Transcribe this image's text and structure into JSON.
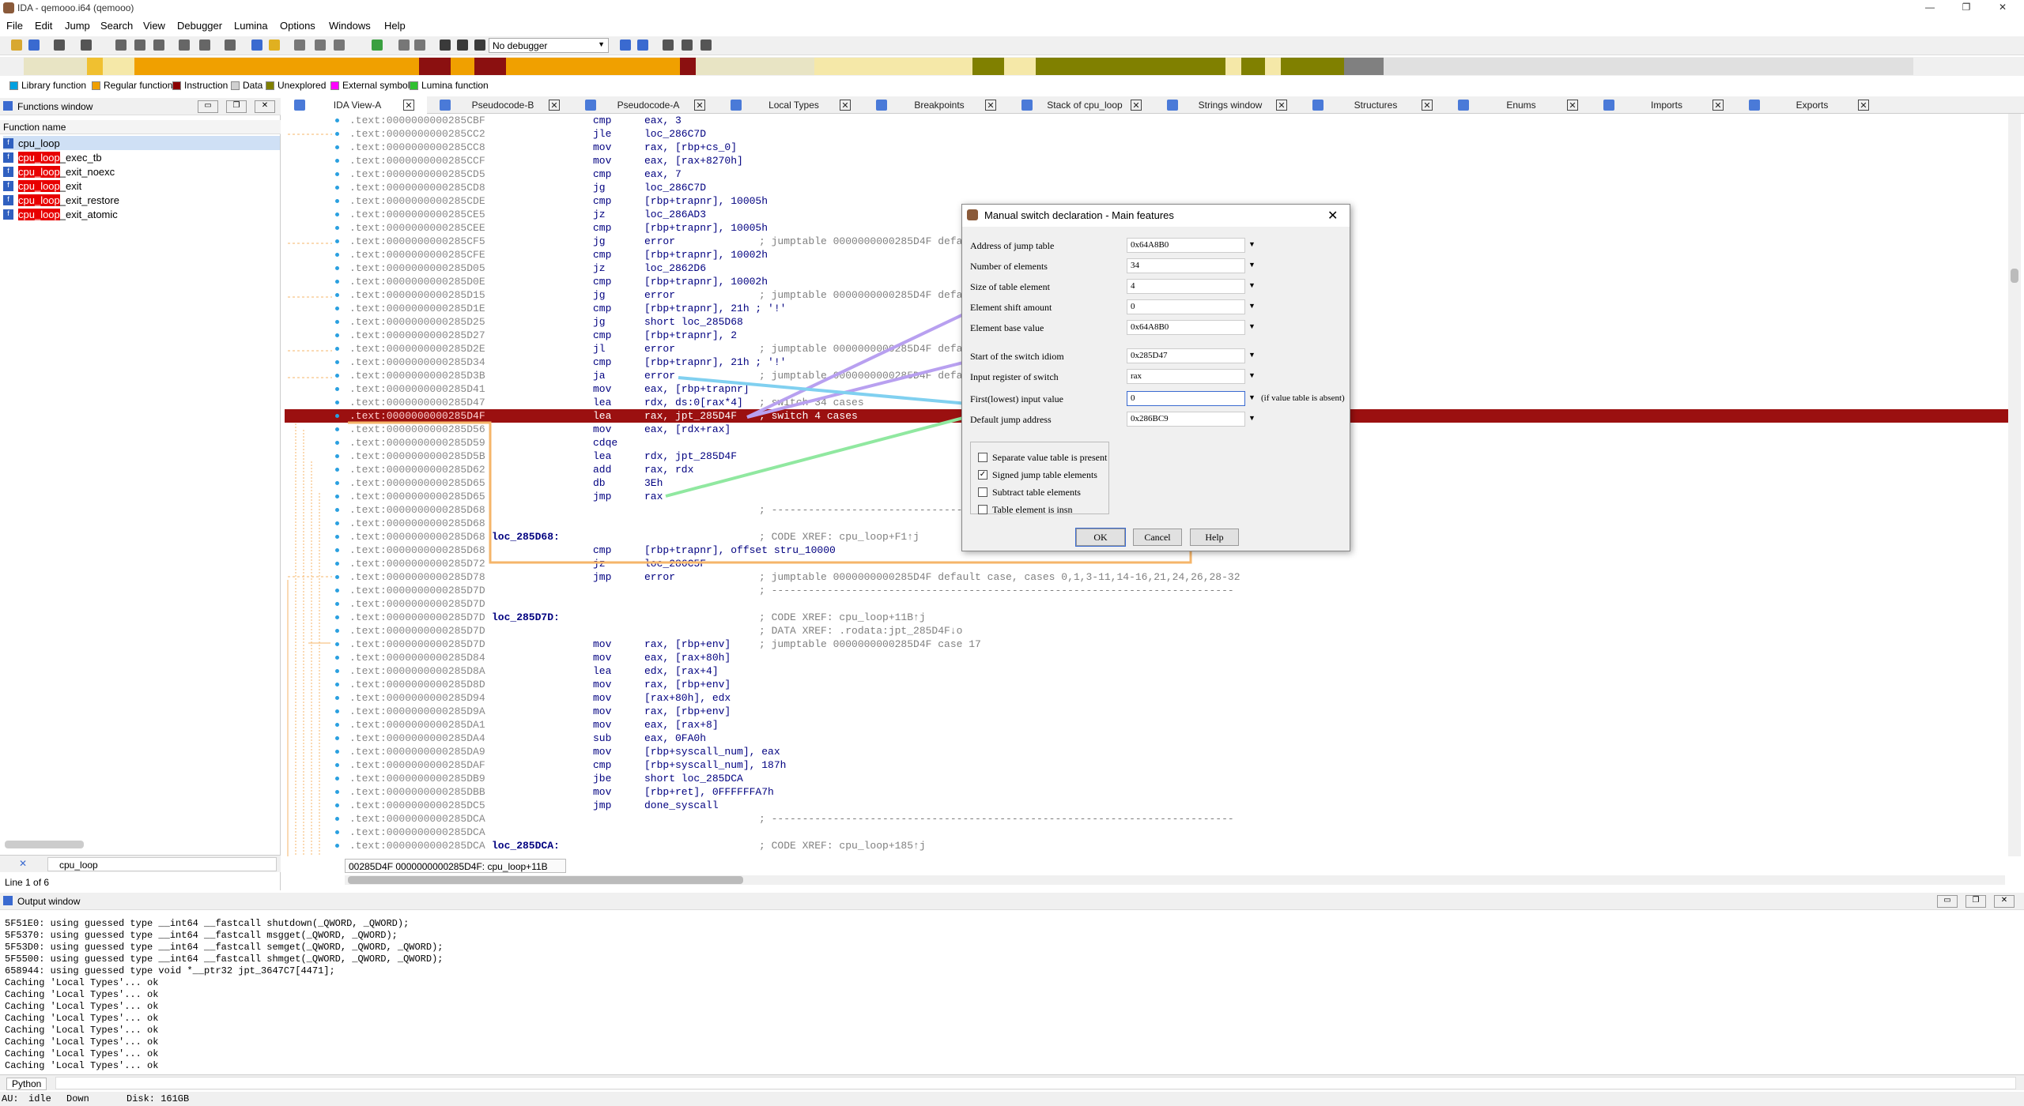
{
  "window": {
    "title": "IDA - qemooo.i64 (qemooo)"
  },
  "menu": [
    "File",
    "Edit",
    "Jump",
    "Search",
    "View",
    "Debugger",
    "Lumina",
    "Options",
    "Windows",
    "Help"
  ],
  "toolbar": {
    "debugger": "No debugger"
  },
  "legend": [
    {
      "label": "Library function",
      "color": "#00a0e0"
    },
    {
      "label": "Regular function",
      "color": "#f0a000"
    },
    {
      "label": "Instruction",
      "color": "#8b0000"
    },
    {
      "label": "Data",
      "color": "#d0d0d0"
    },
    {
      "label": "Unexplored",
      "color": "#808000"
    },
    {
      "label": "External symbol",
      "color": "#ff00ff"
    },
    {
      "label": "Lumina function",
      "color": "#30c030"
    }
  ],
  "functions": {
    "title": "Functions window",
    "column": "Function name",
    "items": [
      {
        "hl": "",
        "rest": "cpu_loop"
      },
      {
        "hl": "cpu_loop",
        "rest": "_exec_tb"
      },
      {
        "hl": "cpu_loop",
        "rest": "_exit_noexc"
      },
      {
        "hl": "cpu_loop",
        "rest": "_exit"
      },
      {
        "hl": "cpu_loop",
        "rest": "_exit_restore"
      },
      {
        "hl": "cpu_loop",
        "rest": "_exit_atomic"
      }
    ],
    "filter": "cpu_loop",
    "line_info": "Line 1 of 6"
  },
  "tabs": [
    "IDA View-A",
    "Pseudocode-B",
    "Pseudocode-A",
    "Local Types",
    "Breakpoints",
    "Stack of cpu_loop",
    "Strings window",
    "Structures",
    "Enums",
    "Imports",
    "Exports"
  ],
  "code": [
    {
      "a": ".text:0000000000285CBF",
      "m": "cmp",
      "o": "eax, 3"
    },
    {
      "a": ".text:0000000000285CC2",
      "m": "jle",
      "o": "loc_286C7D"
    },
    {
      "a": ".text:0000000000285CC8",
      "m": "mov",
      "o": "rax, [rbp+cs_0]"
    },
    {
      "a": ".text:0000000000285CCF",
      "m": "mov",
      "o": "eax, [rax+8270h]"
    },
    {
      "a": ".text:0000000000285CD5",
      "m": "cmp",
      "o": "eax, 7"
    },
    {
      "a": ".text:0000000000285CD8",
      "m": "jg",
      "o": "loc_286C7D"
    },
    {
      "a": ".text:0000000000285CDE",
      "m": "cmp",
      "o": "[rbp+trapnr], 10005h"
    },
    {
      "a": ".text:0000000000285CE5",
      "m": "jz",
      "o": "loc_286AD3"
    },
    {
      "a": ".text:0000000000285CEE",
      "m": "cmp",
      "o": "[rbp+trapnr], 10005h"
    },
    {
      "a": ".text:0000000000285CF5",
      "m": "jg",
      "o": "error",
      "c": "; jumptable 0000000000285D4F defau"
    },
    {
      "a": ".text:0000000000285CFE",
      "m": "cmp",
      "o": "[rbp+trapnr], 10002h"
    },
    {
      "a": ".text:0000000000285D05",
      "m": "jz",
      "o": "loc_2862D6"
    },
    {
      "a": ".text:0000000000285D0E",
      "m": "cmp",
      "o": "[rbp+trapnr], 10002h"
    },
    {
      "a": ".text:0000000000285D15",
      "m": "jg",
      "o": "error",
      "c": "; jumptable 0000000000285D4F defau"
    },
    {
      "a": ".text:0000000000285D1E",
      "m": "cmp",
      "o": "[rbp+trapnr], 21h ; '!'"
    },
    {
      "a": ".text:0000000000285D25",
      "m": "jg",
      "o": "short loc_285D68"
    },
    {
      "a": ".text:0000000000285D27",
      "m": "cmp",
      "o": "[rbp+trapnr], 2"
    },
    {
      "a": ".text:0000000000285D2E",
      "m": "jl",
      "o": "error",
      "c": "; jumptable 0000000000285D4F defau"
    },
    {
      "a": ".text:0000000000285D34",
      "m": "cmp",
      "o": "[rbp+trapnr], 21h ; '!'"
    },
    {
      "a": ".text:0000000000285D3B",
      "m": "ja",
      "o": "error",
      "c": "; jumptable 0000000000285D4F defau"
    },
    {
      "a": ".text:0000000000285D41",
      "m": "mov",
      "o": "eax, [rbp+trapnr]"
    },
    {
      "a": ".text:0000000000285D47",
      "m": "lea",
      "o": "rdx, ds:0[rax*4]",
      "c": "; switch 34 cases"
    },
    {
      "a": ".text:0000000000285D4F",
      "m": "lea",
      "o": "rax, jpt_285D4F",
      "c": "; switch 4 cases",
      "sel": true
    },
    {
      "a": ".text:0000000000285D56",
      "m": "mov",
      "o": "eax, [rdx+rax]"
    },
    {
      "a": ".text:0000000000285D59",
      "m": "cdqe",
      "o": ""
    },
    {
      "a": ".text:0000000000285D5B",
      "m": "lea",
      "o": "rdx, jpt_285D4F"
    },
    {
      "a": ".text:0000000000285D62",
      "m": "add",
      "o": "rax, rdx"
    },
    {
      "a": ".text:0000000000285D65",
      "m": "db",
      "o": "3Eh"
    },
    {
      "a": ".text:0000000000285D65",
      "m": "jmp",
      "o": "rax"
    },
    {
      "a": ".text:0000000000285D68",
      "m": "",
      "o": "",
      "c": "; ---------------------------------------------------------------------------"
    },
    {
      "a": ".text:0000000000285D68",
      "m": "",
      "o": ""
    },
    {
      "a": ".text:0000000000285D68",
      "l": "loc_285D68:",
      "m": "",
      "o": "",
      "c": "; CODE XREF: cpu_loop+F1↑j"
    },
    {
      "a": ".text:0000000000285D68",
      "m": "cmp",
      "o": "[rbp+trapnr], offset stru_10000"
    },
    {
      "a": ".text:0000000000285D72",
      "m": "jz",
      "o": "loc_286C5F"
    },
    {
      "a": ".text:0000000000285D78",
      "m": "jmp",
      "o": "error",
      "c": "; jumptable 0000000000285D4F default case, cases 0,1,3-11,14-16,21,24,26,28-32"
    },
    {
      "a": ".text:0000000000285D7D",
      "m": "",
      "o": "",
      "c": "; ---------------------------------------------------------------------------"
    },
    {
      "a": ".text:0000000000285D7D",
      "m": "",
      "o": ""
    },
    {
      "a": ".text:0000000000285D7D",
      "l": "loc_285D7D:",
      "m": "",
      "o": "",
      "c": "; CODE XREF: cpu_loop+11B↑j"
    },
    {
      "a": ".text:0000000000285D7D",
      "m": "",
      "o": "",
      "c": "; DATA XREF: .rodata:jpt_285D4F↓o"
    },
    {
      "a": ".text:0000000000285D7D",
      "m": "mov",
      "o": "rax, [rbp+env]",
      "c": "; jumptable 0000000000285D4F case 17"
    },
    {
      "a": ".text:0000000000285D84",
      "m": "mov",
      "o": "eax, [rax+80h]"
    },
    {
      "a": ".text:0000000000285D8A",
      "m": "lea",
      "o": "edx, [rax+4]"
    },
    {
      "a": ".text:0000000000285D8D",
      "m": "mov",
      "o": "rax, [rbp+env]"
    },
    {
      "a": ".text:0000000000285D94",
      "m": "mov",
      "o": "[rax+80h], edx"
    },
    {
      "a": ".text:0000000000285D9A",
      "m": "mov",
      "o": "rax, [rbp+env]"
    },
    {
      "a": ".text:0000000000285DA1",
      "m": "mov",
      "o": "eax, [rax+8]"
    },
    {
      "a": ".text:0000000000285DA4",
      "m": "sub",
      "o": "eax, 0FA0h"
    },
    {
      "a": ".text:0000000000285DA9",
      "m": "mov",
      "o": "[rbp+syscall_num], eax"
    },
    {
      "a": ".text:0000000000285DAF",
      "m": "cmp",
      "o": "[rbp+syscall_num], 187h"
    },
    {
      "a": ".text:0000000000285DB9",
      "m": "jbe",
      "o": "short loc_285DCA"
    },
    {
      "a": ".text:0000000000285DBB",
      "m": "mov",
      "o": "[rbp+ret], 0FFFFFFA7h"
    },
    {
      "a": ".text:0000000000285DC5",
      "m": "jmp",
      "o": "done_syscall"
    },
    {
      "a": ".text:0000000000285DCA",
      "m": "",
      "o": "",
      "c": "; ---------------------------------------------------------------------------"
    },
    {
      "a": ".text:0000000000285DCA",
      "m": "",
      "o": ""
    },
    {
      "a": ".text:0000000000285DCA",
      "l": "loc_285DCA:",
      "m": "",
      "o": "",
      "c": "; CODE XREF: cpu_loop+185↑j"
    }
  ],
  "code_status": "00285D4F 0000000000285D4F: cpu_loop+11B",
  "output": {
    "title": "Output window",
    "lines": [
      "5F51E0: using guessed type __int64 __fastcall shutdown(_QWORD, _QWORD);",
      "5F5370: using guessed type __int64 __fastcall msgget(_QWORD, _QWORD);",
      "5F53D0: using guessed type __int64 __fastcall semget(_QWORD, _QWORD, _QWORD);",
      "5F5500: using guessed type __int64 __fastcall shmget(_QWORD, _QWORD, _QWORD);",
      "658944: using guessed type void *__ptr32 jpt_3647C7[4471];",
      "Caching 'Local Types'... ok",
      "Caching 'Local Types'... ok",
      "Caching 'Local Types'... ok",
      "Caching 'Local Types'... ok",
      "Caching 'Local Types'... ok",
      "Caching 'Local Types'... ok",
      "Caching 'Local Types'... ok",
      "Caching 'Local Types'... ok"
    ],
    "python_label": "Python"
  },
  "status": {
    "au": "AU:",
    "state": "idle",
    "dir": "Down",
    "disk": "Disk: 161GB"
  },
  "dialog": {
    "title": "Manual switch declaration - Main features",
    "fields": [
      {
        "label": "Address of jump table",
        "value": "0x64A8B0"
      },
      {
        "label": "Number of elements",
        "value": "34"
      },
      {
        "label": "Size of table element",
        "value": "4"
      },
      {
        "label": "Element shift amount",
        "value": "0"
      },
      {
        "label": "Element base value",
        "value": "0x64A8B0"
      },
      {
        "label": "Start of the switch idiom",
        "value": "0x285D47"
      },
      {
        "label": "Input register of switch",
        "value": "rax"
      },
      {
        "label": "First(lowest) input value",
        "value": "0",
        "hint": "(if value table is absent)"
      },
      {
        "label": "Default jump address",
        "value": "0x286BC9"
      }
    ],
    "checks": [
      {
        "label": "Separate value table is present",
        "checked": false
      },
      {
        "label": "Signed jump table elements",
        "checked": true
      },
      {
        "label": "Subtract table elements",
        "checked": false
      },
      {
        "label": "Table element is insn",
        "checked": false
      }
    ],
    "ok": "OK",
    "cancel": "Cancel",
    "help": "Help"
  },
  "colors": {
    "highlight_row": "#9b1010",
    "annotation_orange": "#f5b56a",
    "annotation_purple": "#b8a0f0",
    "annotation_cyan": "#80d0f0",
    "annotation_green": "#90e8a0"
  }
}
